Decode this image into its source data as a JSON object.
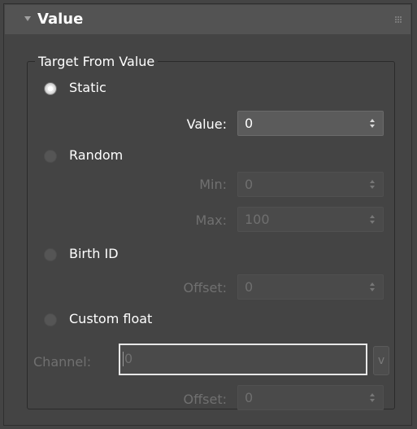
{
  "rollout": {
    "title": "Value"
  },
  "group": {
    "title": "Target From Value"
  },
  "options": {
    "static": {
      "label": "Static",
      "selected": true
    },
    "random": {
      "label": "Random",
      "selected": false
    },
    "birth_id": {
      "label": "Birth ID",
      "selected": false
    },
    "custom_float": {
      "label": "Custom float",
      "selected": false
    }
  },
  "fields": {
    "static_value": {
      "label": "Value:",
      "value": "0",
      "enabled": true
    },
    "random_min": {
      "label": "Min:",
      "value": "0",
      "enabled": false
    },
    "random_max": {
      "label": "Max:",
      "value": "100",
      "enabled": false
    },
    "birth_offset": {
      "label": "Offset:",
      "value": "0",
      "enabled": false
    },
    "channel": {
      "label": "Channel:",
      "value": "0",
      "button_label": "v",
      "enabled": false
    },
    "custom_offset": {
      "label": "Offset:",
      "value": "0",
      "enabled": false
    }
  },
  "colors": {
    "panel_bg": "#444444",
    "header_bg": "#535353",
    "text_enabled": "#ffffff",
    "text_disabled": "#707070"
  }
}
